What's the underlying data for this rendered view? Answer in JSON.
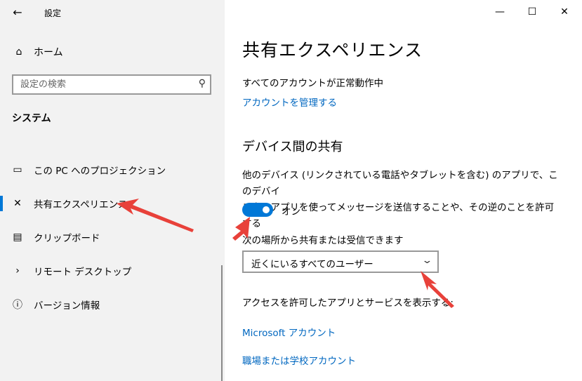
{
  "window": {
    "title": "設定",
    "back_icon": "back-arrow-icon",
    "minimize": "—",
    "maximize": "☐",
    "close": "✕"
  },
  "sidebar": {
    "home_label": "ホーム",
    "search_placeholder": "設定の検索",
    "section_title": "システム",
    "items": [
      {
        "label": "この PC へのプロジェクション",
        "icon": "projection-icon"
      },
      {
        "label": "共有エクスペリエンス",
        "icon": "shared-experiences-icon",
        "active": true
      },
      {
        "label": "クリップボード",
        "icon": "clipboard-icon"
      },
      {
        "label": "リモート デスクトップ",
        "icon": "remote-desktop-icon"
      },
      {
        "label": "バージョン情報",
        "icon": "info-icon"
      }
    ]
  },
  "main": {
    "title": "共有エクスペリエンス",
    "account_status": "すべてのアカウントが正常動作中",
    "manage_accounts": "アカウントを管理する",
    "cross_device_heading": "デバイス間の共有",
    "description_line1": "他のデバイス (リンクされている電話やタブレットを含む) のアプリで、このデバイ",
    "description_line2": "ス上のアプリを使ってメッセージを送信することや、その逆のことを許可する",
    "toggle_label": "オン",
    "toggle_on": true,
    "share_from_label": "次の場所から共有または受信できます",
    "dropdown_value": "近くにいるすべてのユーザー",
    "access_label": "アクセスを許可したアプリとサービスを表示する:",
    "microsoft_account": "Microsoft アカウント",
    "work_school_account": "職場または学校アカウント"
  },
  "colors": {
    "accent": "#0078d7",
    "link": "#0067c0",
    "annotation_arrow": "#e8413a"
  }
}
